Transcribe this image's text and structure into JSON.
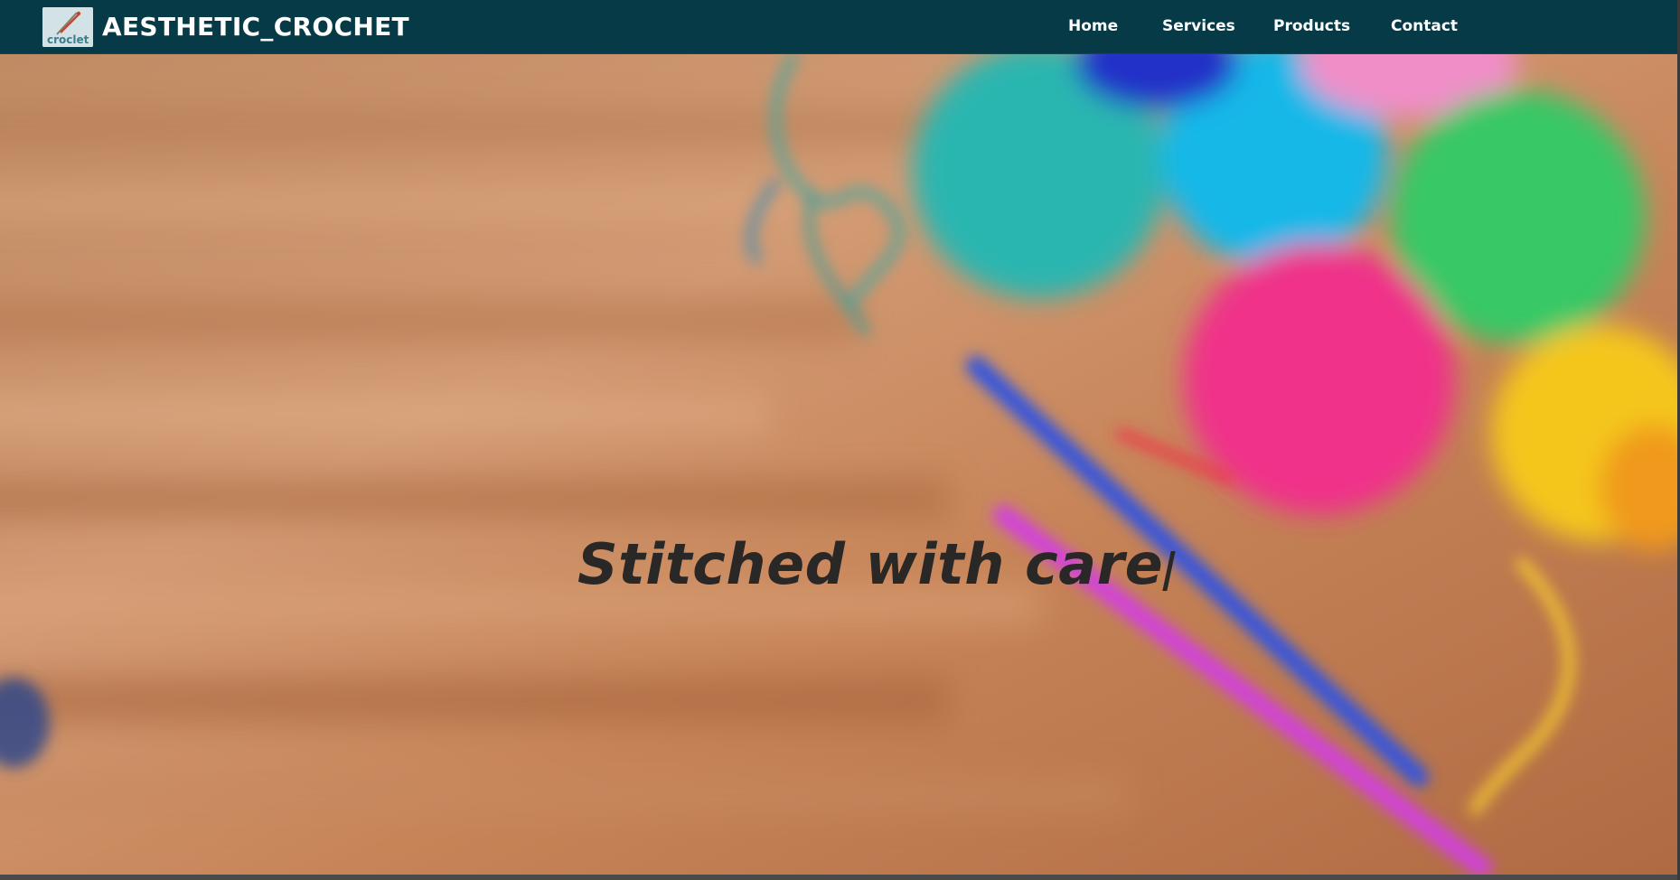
{
  "header": {
    "logo_text": "croclet",
    "brand_title": "AESTHETIC_CROCHET",
    "nav": {
      "home": "Home",
      "services": "Services",
      "products": "Products",
      "contact": "Contact"
    }
  },
  "hero": {
    "tagline": "Stitched with care"
  },
  "colors": {
    "navbar": "#063a47",
    "text_dark": "#2a2827"
  }
}
